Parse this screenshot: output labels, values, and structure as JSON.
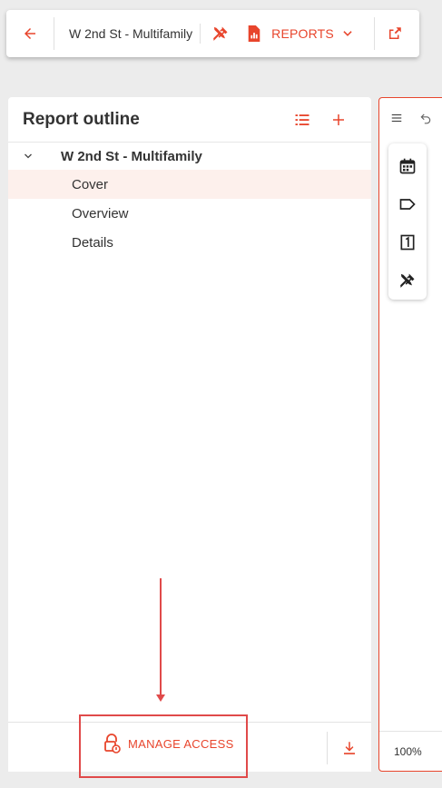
{
  "topbar": {
    "project_title": "W 2nd St - Multifamily",
    "reports_label": "REPORTS"
  },
  "outline": {
    "title": "Report outline",
    "root_label": "W 2nd St - Multifamily",
    "items": [
      {
        "label": "Cover",
        "active": true
      },
      {
        "label": "Overview",
        "active": false
      },
      {
        "label": "Details",
        "active": false
      }
    ]
  },
  "footer": {
    "manage_access_label": "MANAGE ACCESS"
  },
  "right_panel": {
    "zoom": "100%"
  },
  "colors": {
    "accent": "#e8452c",
    "callout": "#e04a4a",
    "active_row": "#fdf0ec"
  }
}
